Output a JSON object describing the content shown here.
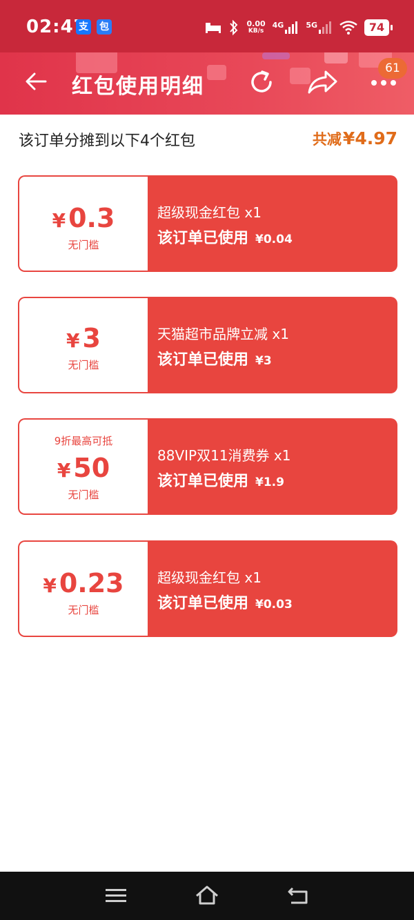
{
  "status_bar": {
    "time": "02:47",
    "app_icons": [
      "alipay-icon",
      "app-icon"
    ],
    "alipay_glyph": "支",
    "app_glyph": "包",
    "net_speed_value": "0.00",
    "net_speed_unit": "KB/s",
    "net1": "4G",
    "net2": "5G",
    "battery": "74"
  },
  "header": {
    "title": "红包使用明细",
    "badge": "61"
  },
  "summary": {
    "text": "该订单分摊到以下4个红包",
    "total_label": "共减",
    "total_amount": "¥4.97"
  },
  "coupons": [
    {
      "value": "0.3",
      "yen": "¥",
      "top_note": "",
      "threshold": "无门槛",
      "name": "超级现金红包 x1",
      "used_label": "该订单已使用",
      "used_amount": "¥0.04"
    },
    {
      "value": "3",
      "yen": "¥",
      "top_note": "",
      "threshold": "无门槛",
      "name": "天猫超市品牌立减 x1",
      "used_label": "该订单已使用",
      "used_amount": "¥3"
    },
    {
      "value": "50",
      "yen": "¥",
      "top_note": "9折最高可抵",
      "threshold": "无门槛",
      "name": "88VIP双11消费券 x1",
      "used_label": "该订单已使用",
      "used_amount": "¥1.9"
    },
    {
      "value": "0.23",
      "yen": "¥",
      "top_note": "",
      "threshold": "无门槛",
      "name": "超级现金红包 x1",
      "used_label": "该订单已使用",
      "used_amount": "¥0.03"
    }
  ],
  "colors": {
    "status_bar": "#c8283a",
    "header": "#e0344a",
    "coupon": "#e8453f",
    "total": "#e06c1a",
    "badge": "#ec6a35"
  }
}
